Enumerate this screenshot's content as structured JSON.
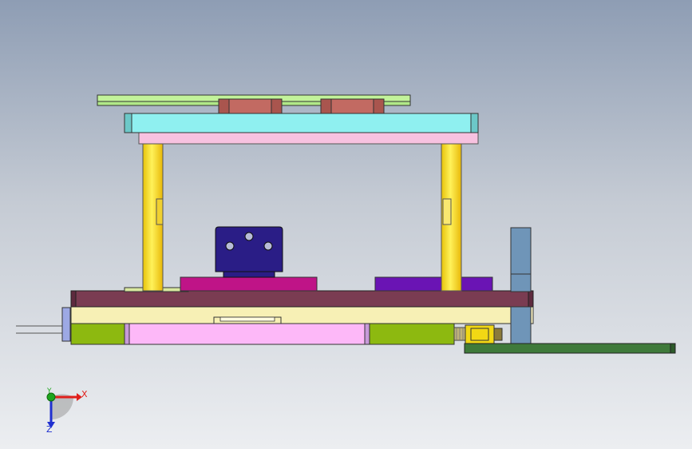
{
  "viewport": {
    "background_top": "#8e9db4",
    "background_bottom": "#eceef1"
  },
  "triad": {
    "x_label": "X",
    "y_label": "Y",
    "z_label": "Z",
    "x_color": "#e0201c",
    "y_color": "#1ea51e",
    "z_color": "#2030d0"
  },
  "model": {
    "parts": [
      "top-plate-green",
      "clamp-block-left",
      "clamp-block-right",
      "upper-plate-cyan",
      "guide-pillar-left",
      "guide-pillar-right",
      "mount-block-navy",
      "pad-magenta",
      "pad-purple",
      "base-plate-maroon",
      "base-plate-cream",
      "bottom-plate-lime",
      "bottom-plate-pink",
      "side-column-blue",
      "cylinder-yellow",
      "rail-green",
      "rod-left"
    ],
    "colors": {
      "top_plate": "#c2f39a",
      "clamp_block": "#c26a62",
      "upper_plate": "#8ff0f0",
      "pillar": "#f5e01a",
      "mount_block": "#2a1d86",
      "pad_magenta": "#bf1487",
      "pad_purple": "#6a14b4",
      "base_maroon": "#7a3c52",
      "base_cream": "#f7f0b5",
      "bottom_lime": "#8db910",
      "bottom_pink": "#fdb8f8",
      "side_column": "#6f95b8",
      "cylinder": "#f2d814",
      "rail": "#3f7a3a"
    }
  }
}
